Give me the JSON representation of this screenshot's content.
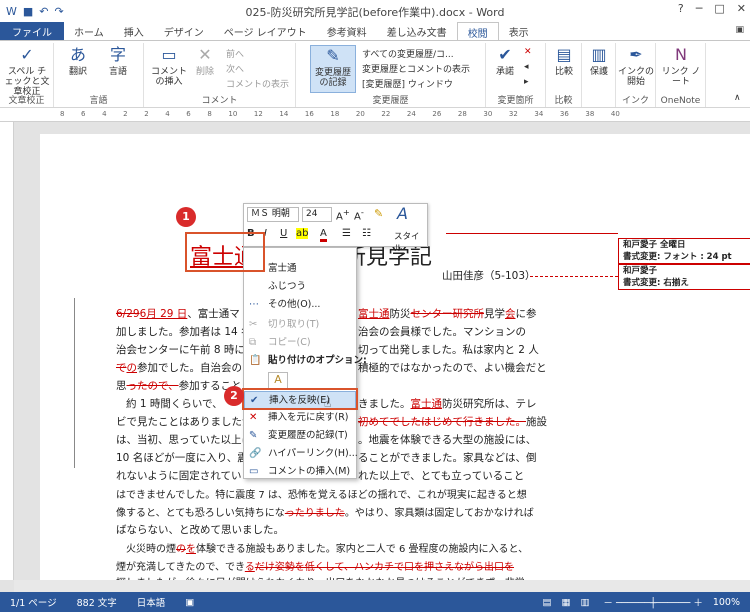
{
  "window": {
    "title": "025-防災研究所見学記(before作業中).docx - Word",
    "user": "ユーザー"
  },
  "tabs": [
    "ファイル",
    "ホーム",
    "挿入",
    "デザイン",
    "ページ レイアウト",
    "参考資料",
    "差し込み文書",
    "校閲",
    "表示"
  ],
  "ribbon": {
    "proofing": {
      "btn": "スペル チェックと文章校正",
      "name": "文章校正"
    },
    "language": {
      "translate": "翻訳",
      "lang": "言語",
      "name": "言語"
    },
    "comments": {
      "new": "コメントの挿入",
      "delete": "削除",
      "prev": "前へ",
      "next": "次へ",
      "show": "コメントの表示",
      "name": "コメント"
    },
    "tracking": {
      "track": "変更履歴の記録",
      "markup": "すべての変更履歴/コ...",
      "show_markup": "変更履歴とコメントの表示",
      "pane": "[変更履歴] ウィンドウ",
      "name": "変更履歴"
    },
    "changes": {
      "accept": "承諾",
      "name": "変更箇所"
    },
    "compare": {
      "btn": "比較",
      "name": "比較"
    },
    "protect": {
      "btn": "保護"
    },
    "ink": {
      "btn": "インクの開始",
      "name": "インク"
    },
    "onenote": {
      "btn": "リンク ノート",
      "name": "OneNote"
    }
  },
  "doc": {
    "title_ins": "富士通",
    "title_rest": "防災研究所見学記",
    "author": "山田佳彦（5-103）",
    "l1_del": "6/29",
    "l1_ins": "6月 29 日",
    "l1_rest": "、富士通マ",
    "l1_b": "富士通",
    "l1_c": "防災",
    "l1_d": "センター研究所",
    "l1_e": "見学",
    "l1_f": "会",
    "l1_g": "に参",
    "l2": "加しました。参加者は 14 名",
    "l2b": "治会の会員様でした。マンションの",
    "l3": "治会センターに午前 8 時に",
    "l3b": "切って出発しました。私は家内と 2 人",
    "l4a": "で",
    "l4b": "の",
    "l4c": "参加でした。自治会の",
    "l4d": "積極的ではなかったので、よい機会だと",
    "l5a": "思",
    "l5b": "ったので、",
    "l5c": "参加すること",
    "l6": "約 1 時間くらいで、",
    "l6b": "きました。",
    "l6c": "富士通",
    "l6d": "防災研究所は、テレ",
    "l7": "ビで見たことはありましたが",
    "l7b": "初めてでしたはじめて行きました。",
    "l7c": "施設",
    "l8": "は、当初、思っていた以上に",
    "l8b": "。地震を体験できる大型の施設には、",
    "l9": "10 名ほどが一度に入り、震",
    "l9b": "ることができました。家具などは、倒",
    "l10": "れないように固定されてい",
    "l10b": "れた以上で、とても立っていること",
    "l11": "はできませんでした。特に震度 7 は、恐怖を覚えるほどの揺れで、これが現実に起きると想",
    "l12a": "像すると、とても恐ろしい気持ちにな",
    "l12b": "ったりました",
    "l12c": "。やはり、家具類は固定しておかなければ",
    "l13": "ばならない、と改めて思いました。",
    "l14a": "火災時の煙",
    "l14b": "の",
    "l14c": "を",
    "l14d": "体験できる施設もありました。家内と二人で 6 畳程度の施設内に入ると、",
    "l15a": "煙が充満してきたので、でき",
    "l15b": "る",
    "l15c": "だけ姿勢を低くして、ハンカチで口を押さえながら出口を",
    "l16": "探しましたが、徐々に目が開けられなくなり、出口をなかなか見つけることができず、非常"
  },
  "balloons": [
    {
      "l1": "和戸愛子 全曜日",
      "l2": "書式変更: フォント : 24 pt"
    },
    {
      "l1": "和戸愛子",
      "l2": "書式変更: 右揃え"
    }
  ],
  "minitoolbar": {
    "font": "ＭＳ 明朝",
    "size": "24",
    "style": "スタイル"
  },
  "context_menu": {
    "items": [
      "富士通",
      "ふじつう",
      "その他(O)...",
      "切り取り(T)",
      "コピー(C)",
      "貼り付けのオプション:",
      "挿入を反映(E)",
      "挿入を元に戻す(R)",
      "変更履歴の記録(T)",
      "ハイパーリンク(H)...",
      "コメントの挿入(M)"
    ]
  },
  "markers": [
    "1",
    "2"
  ],
  "status": {
    "page": "1/1 ページ",
    "words": "882 文字",
    "lang": "日本語",
    "zoom": "100%"
  }
}
